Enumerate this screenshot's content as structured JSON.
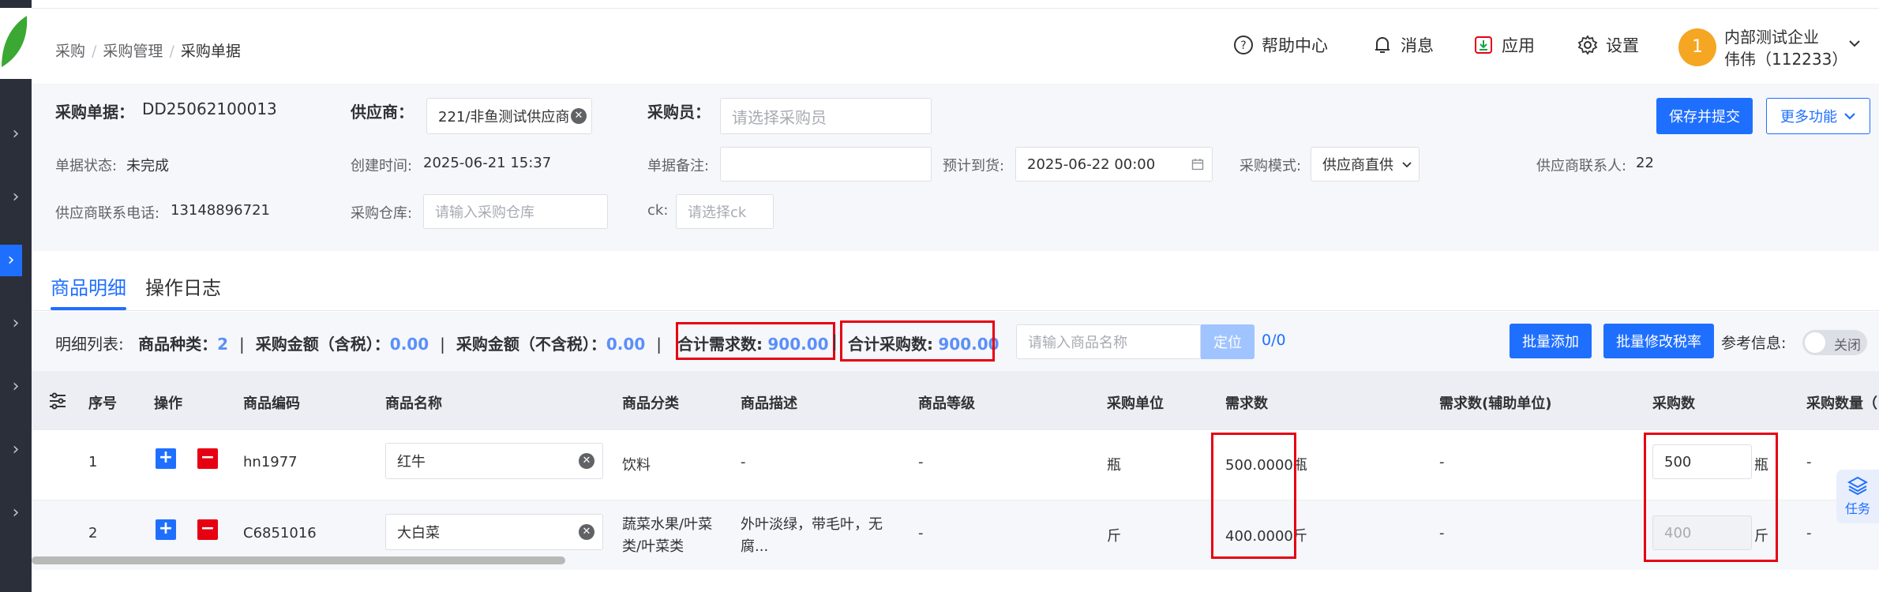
{
  "breadcrumb": [
    "采购",
    "采购管理",
    "采购单据"
  ],
  "header": {
    "help": "帮助中心",
    "messages": "消息",
    "apps": "应用",
    "settings": "设置",
    "avatar": "1",
    "company": "内部测试企业",
    "user": "伟伟（112233）"
  },
  "form": {
    "order_label": "采购单据：",
    "order_no": "DD25062100013",
    "supplier_label": "供应商：",
    "supplier_value": "221/非鱼测试供应商",
    "buyer_label": "采购员：",
    "buyer_placeholder": "请选择采购员",
    "status_label": "单据状态:",
    "status_value": "未完成",
    "created_label": "创建时间:",
    "created_value": "2025-06-21 15:37",
    "remark_label": "单据备注:",
    "eta_label": "预计到货:",
    "eta_value": "2025-06-22 00:00",
    "mode_label": "采购模式:",
    "mode_value": "供应商直供",
    "contact_label": "供应商联系人:",
    "contact_value": "22",
    "phone_label": "供应商联系电话:",
    "phone_value": "13148896721",
    "warehouse_label": "采购仓库:",
    "warehouse_placeholder": "请输入采购仓库",
    "ck_label": "ck:",
    "ck_placeholder": "请选择ck",
    "save_btn": "保存并提交",
    "more_btn": "更多功能"
  },
  "tabs": [
    "商品明细",
    "操作日志"
  ],
  "summary": {
    "list_label": "明细列表:",
    "kinds_label": "商品种类：",
    "kinds_value": "2",
    "amount_tax_label": "采购金额（含税）：",
    "amount_tax_value": "0.00",
    "amount_notax_label": "采购金额（不含税）：",
    "amount_notax_value": "0.00",
    "total_demand_label": "合计需求数:",
    "total_demand_value": "900.00",
    "total_purchase_label": "合计采购数:",
    "total_purchase_value": "900.00",
    "search_placeholder": "请输入商品名称",
    "locate_btn": "定位",
    "counter": "0/0",
    "batch_add": "批量添加",
    "batch_tax": "批量修改税率",
    "ref_label": "参考信息:",
    "toggle_text": "关闭"
  },
  "table": {
    "headers": [
      "序号",
      "操作",
      "商品编码",
      "商品名称",
      "商品分类",
      "商品描述",
      "商品等级",
      "采购单位",
      "需求数",
      "需求数(辅助单位)",
      "采购数",
      "采购数量（"
    ],
    "rows": [
      {
        "idx": "1",
        "code": "hn1977",
        "name": "红牛",
        "category": "饮料",
        "category2": "",
        "desc": "-",
        "desc2": "",
        "grade": "-",
        "unit": "瓶",
        "demand": "500.0000瓶",
        "demand_aux": "-",
        "purchase": "500",
        "purchase_unit": "瓶",
        "purchase_qty": "-"
      },
      {
        "idx": "2",
        "code": "C6851016",
        "name": "大白菜",
        "category": "蔬菜水果/叶菜",
        "category2": "类/叶菜类",
        "desc": "外叶淡绿，带毛叶，无",
        "desc2": "腐...",
        "grade": "-",
        "unit": "斤",
        "demand": "400.0000斤",
        "demand_aux": "-",
        "purchase": "400",
        "purchase_unit": "斤",
        "purchase_qty": "-"
      }
    ]
  },
  "task_btn": "任务",
  "colors": {
    "primary": "#1f6fff",
    "danger": "#e60012",
    "avatar": "#f5a623",
    "sidebar": "#2b2f3a"
  }
}
